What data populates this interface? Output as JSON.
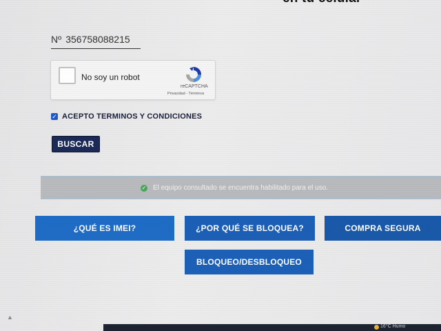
{
  "page": {
    "heading_partial": "en tu celular"
  },
  "imei": {
    "prefix": "Nº",
    "value": "356758088215"
  },
  "captcha": {
    "label": "No soy un robot",
    "brand": "reCAPTCHA",
    "links": "Privacidad - Términos"
  },
  "terms": {
    "checked": true,
    "label": "ACEPTO TERMINOS Y CONDICIONES"
  },
  "search_button": "BUSCAR",
  "result": {
    "status_color": "#49a65a",
    "message": "El equipo consultado se encuentra habilitado para el uso."
  },
  "nav": {
    "what_is_imei": "¿QUÉ ES IMEI?",
    "why_blocked": "¿POR QUÉ SE BLOQUEA?",
    "secure_purchase": "COMPRA SEGURA",
    "block_unblock": "BLOQUEO/DESBLOQUEO"
  },
  "taskbar": {
    "weather": "16°C Humo"
  },
  "colors": {
    "nav_button": "#1e67c0",
    "search_button": "#1c2a57"
  }
}
